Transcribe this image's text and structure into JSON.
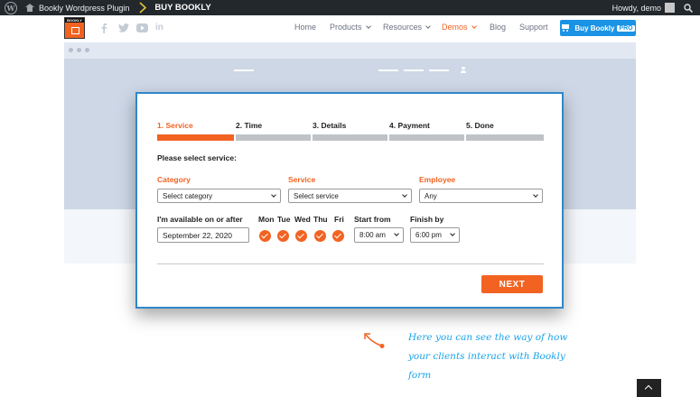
{
  "admin_bar": {
    "site_name": "Bookly Wordpress Plugin",
    "buy_label": "BUY BOOKLY",
    "howdy": "Howdy, demo"
  },
  "header": {
    "logo_text": "BOOKLY",
    "social": [
      "f",
      "t",
      "yt",
      "in"
    ],
    "nav": [
      {
        "label": "Home"
      },
      {
        "label": "Products"
      },
      {
        "label": "Resources"
      },
      {
        "label": "Demos"
      },
      {
        "label": "Blog"
      },
      {
        "label": "Support"
      }
    ],
    "buy_button": {
      "label": "Buy Bookly",
      "badge": "PRO"
    },
    "accent_color": "#f26322",
    "button_color": "#1a93e5"
  },
  "form": {
    "steps": [
      "1. Service",
      "2. Time",
      "3. Details",
      "4. Payment",
      "5. Done"
    ],
    "current_step": 1,
    "prompt": "Please select service:",
    "category": {
      "label": "Category",
      "value": "Select category"
    },
    "service": {
      "label": "Service",
      "value": "Select service"
    },
    "employee": {
      "label": "Employee",
      "value": "Any"
    },
    "available_label": "I'm available on or after",
    "date_value": "September 22, 2020",
    "days": [
      "Mon",
      "Tue",
      "Wed",
      "Thu",
      "Fri"
    ],
    "start_from": {
      "label": "Start from",
      "value": "8:00 am"
    },
    "finish_by": {
      "label": "Finish by",
      "value": "6:00 pm"
    },
    "next_label": "NEXT",
    "border_color": "#2f88c8"
  },
  "annotation": {
    "text_line1": "Here you can see the way of how",
    "text_line2": "your clients interact with Bookly",
    "text_line3": "form"
  }
}
